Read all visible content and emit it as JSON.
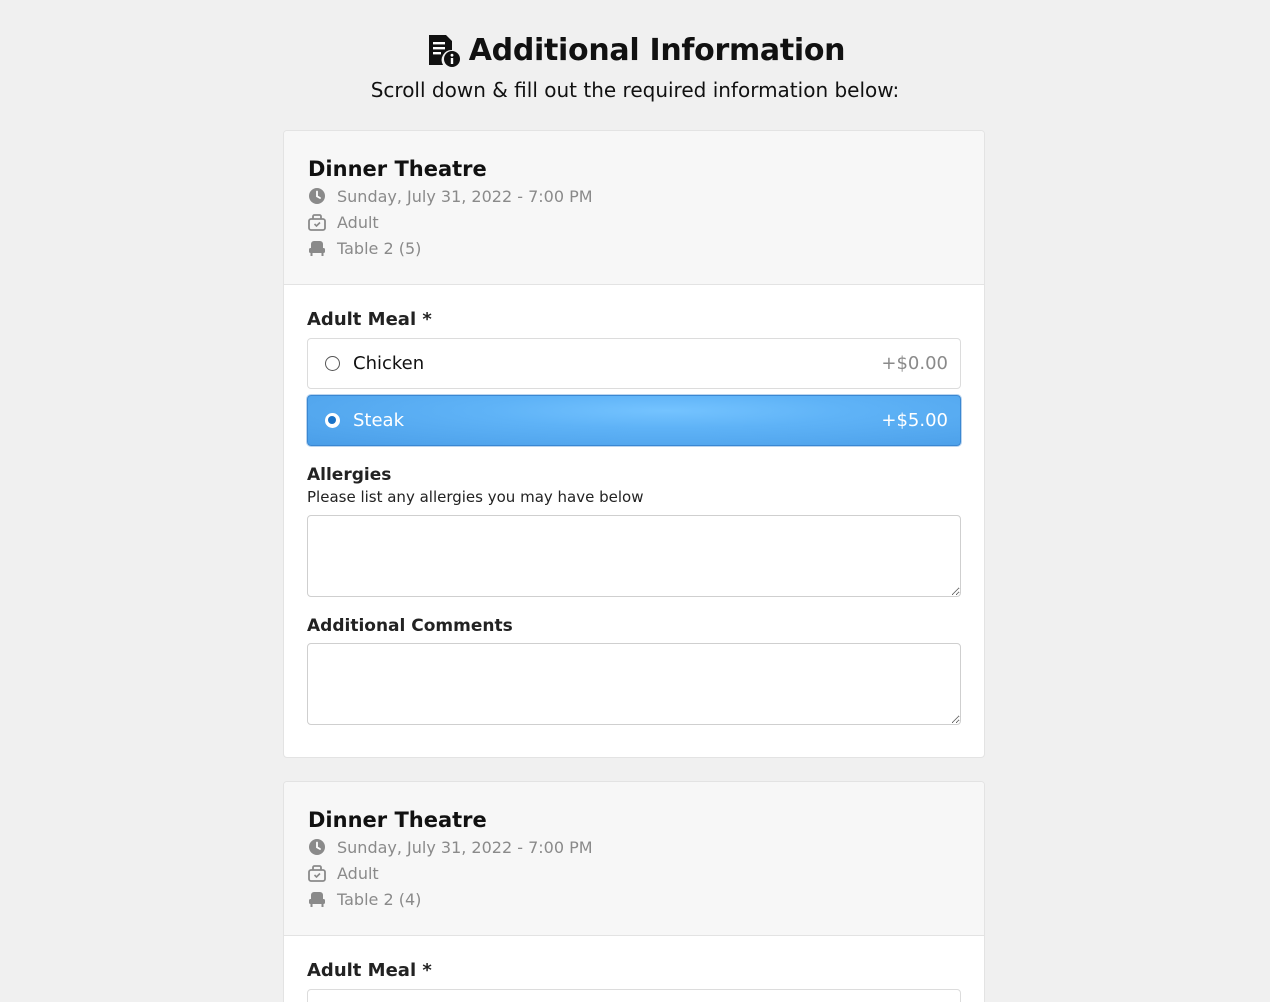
{
  "header": {
    "title": "Additional Information",
    "subtitle": "Scroll down & fill out the required information below:",
    "icon": "document-info-icon"
  },
  "cards": [
    {
      "event_name": "Dinner Theatre",
      "datetime": "Sunday, July 31, 2022 - 7:00 PM",
      "ticket_type": "Adult",
      "seat": "Table 2 (5)",
      "meal_label": "Adult Meal *",
      "options": [
        {
          "label": "Chicken",
          "price": "+$0.00",
          "selected": false
        },
        {
          "label": "Steak",
          "price": "+$5.00",
          "selected": true
        }
      ],
      "allergies_label": "Allergies",
      "allergies_hint": "Please list any allergies you may have below",
      "allergies_value": "",
      "comments_label": "Additional Comments",
      "comments_value": ""
    },
    {
      "event_name": "Dinner Theatre",
      "datetime": "Sunday, July 31, 2022 - 7:00 PM",
      "ticket_type": "Adult",
      "seat": "Table 2 (4)",
      "meal_label": "Adult Meal *"
    }
  ],
  "colors": {
    "background": "#f0f0f0",
    "selected_option": "#5fb3f7",
    "muted_text": "#8a8a8a"
  }
}
